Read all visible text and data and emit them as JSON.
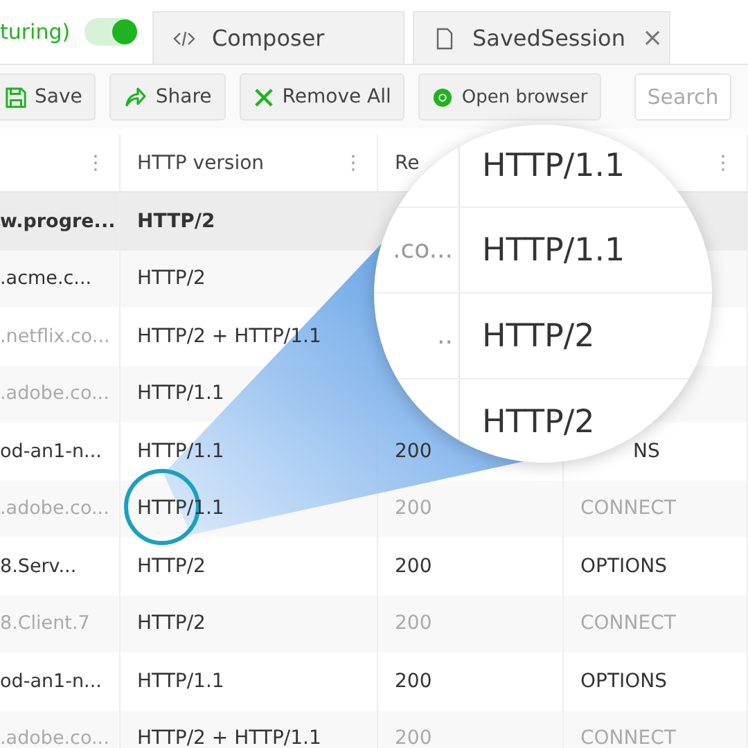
{
  "capture": {
    "label": "turing)",
    "on": true
  },
  "tabs": [
    {
      "label": "Composer"
    },
    {
      "label": "SavedSession",
      "close": "×"
    }
  ],
  "toolbar": [
    {
      "label": "Save"
    },
    {
      "label": "Share"
    },
    {
      "label": "Remove All"
    },
    {
      "label": "Open browser"
    }
  ],
  "search": {
    "placeholder": "Search"
  },
  "table": {
    "columns": [
      {
        "menu": "⋮"
      },
      {
        "label": "HTTP version",
        "menu": "⋮"
      },
      {
        "label": "Re"
      },
      {
        "menu": "⋮"
      }
    ],
    "rows": [
      {
        "host": "w.progre...",
        "version": "HTTP/2",
        "selected": true,
        "dimmed": false
      },
      {
        "host": ".acme.c...",
        "version": "HTTP/2",
        "selected": false,
        "dimmed": false
      },
      {
        "host": ".netflix.co...",
        "version": "HTTP/2 + HTTP/1.1",
        "selected": false,
        "dimmed": true
      },
      {
        "host": ".adobe.co...",
        "version": "HTTP/1.1",
        "selected": false,
        "dimmed": true
      },
      {
        "host": "od-an1-n...",
        "version": "HTTP/1.1",
        "status": "200",
        "method": "NS",
        "selected": false,
        "dimmed": false
      },
      {
        "host": ".adobe.co...",
        "version": "HTTP/1.1",
        "status": "200",
        "method": "CONNECT",
        "selected": false,
        "dimmed": true
      },
      {
        "host": "8.Serv...",
        "version": "HTTP/2",
        "status": "200",
        "method": "OPTIONS",
        "selected": false,
        "dimmed": false
      },
      {
        "host": "8.Client.7",
        "version": "HTTP/2",
        "status": "200",
        "method": "CONNECT",
        "selected": false,
        "dimmed": true
      },
      {
        "host": "od-an1-n...",
        "version": "HTTP/1.1",
        "status": "200",
        "method": "OPTIONS",
        "selected": false,
        "dimmed": false
      },
      {
        "host": ".adobe.co...",
        "version": "HTTP/2 + HTTP/1.1",
        "status": "200",
        "method": "CONNECT",
        "selected": false,
        "dimmed": true
      }
    ]
  },
  "magnifier": {
    "rows": [
      {
        "version": "HTTP/1.1"
      },
      {
        "left": ".co...",
        "version": "HTTP/1.1"
      },
      {
        "left": "..",
        "version": "HTTP/2"
      },
      {
        "version": "HTTP/2"
      }
    ]
  }
}
